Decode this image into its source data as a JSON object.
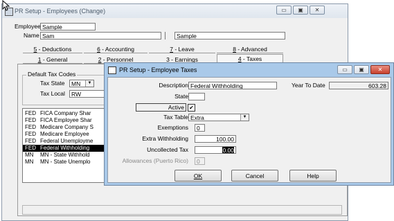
{
  "main_window": {
    "title": "PR Setup - Employees (Change)",
    "employee_label": "Employee",
    "employee_value": "Sample",
    "name_label": "Name",
    "first_name": "Sam",
    "last_name": "Sample",
    "tabs_row1": [
      {
        "key": "5",
        "label": " - Deductions"
      },
      {
        "key": "6",
        "label": " - Accounting"
      },
      {
        "key": "7",
        "label": " - Leave"
      },
      {
        "key": "8",
        "label": " - Advanced"
      }
    ],
    "tabs_row2": [
      {
        "key": "1",
        "label": " - General"
      },
      {
        "key": "2",
        "label": " - Personnel"
      },
      {
        "key": "3",
        "label": " - Earnings"
      },
      {
        "key": "4",
        "label": " - Taxes"
      }
    ],
    "default_tax_codes_label": "Default Tax Codes",
    "tax_state_label": "Tax State",
    "tax_state_value": "MN",
    "tax_local_label": "Tax Local",
    "tax_local_value": "RW",
    "tax_list": [
      {
        "code": "FED",
        "name": "FICA Company Shar"
      },
      {
        "code": "FED",
        "name": "FICA Employee Shar"
      },
      {
        "code": "FED",
        "name": "Medicare Company S"
      },
      {
        "code": "FED",
        "name": "Medicare Employee"
      },
      {
        "code": "FED",
        "name": "Federal Unemployme"
      },
      {
        "code": "FED",
        "name": "Federal Withholding"
      },
      {
        "code": "MN",
        "name": "MN - State Withhold"
      },
      {
        "code": "MN",
        "name": "MN - State Unemplo"
      }
    ],
    "selected_row": 5
  },
  "dialog": {
    "title": "PR Setup - Employee Taxes",
    "description_label": "Description",
    "description_value": "Federal Withholding",
    "ytd_label": "Year To Date",
    "ytd_value": "603.28",
    "state_label": "State",
    "state_value": "",
    "active_label": "Active",
    "active_checked": true,
    "tax_table_label": "Tax Table",
    "tax_table_value": "Extra",
    "exemptions_label": "Exemptions",
    "exemptions_value": "0",
    "extra_withholding_label": "Extra Withholding",
    "extra_withholding_value": "100.00",
    "uncollected_tax_label": "Uncollected Tax",
    "uncollected_tax_value": "0.00",
    "allowances_label": "Allowances (Puerto Rico)",
    "allowances_value": "0",
    "ok_label": "OK",
    "cancel_label": "Cancel",
    "help_label": "Help"
  },
  "glyphs": {
    "minimize": "▭",
    "maximize": "▣",
    "close": "✕",
    "dropdown": "▼",
    "check": "✔"
  },
  "colors": {
    "dialog_title_active": "#a9c9e9",
    "selection": "#000000"
  }
}
